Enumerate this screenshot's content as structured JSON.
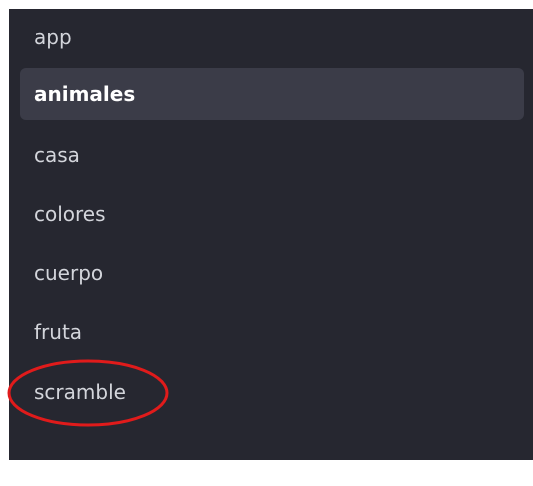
{
  "sidebar": {
    "items": [
      {
        "label": "app",
        "active": false
      },
      {
        "label": "animales",
        "active": true
      },
      {
        "label": "casa",
        "active": false
      },
      {
        "label": "colores",
        "active": false
      },
      {
        "label": "cuerpo",
        "active": false
      },
      {
        "label": "fruta",
        "active": false
      },
      {
        "label": "scramble",
        "active": false
      }
    ]
  },
  "annotation": {
    "target": "scramble",
    "color": "#e01b1b"
  },
  "colors": {
    "panel_background": "#262730",
    "active_background": "#3b3c48",
    "text": "#d3d5db",
    "active_text": "#ffffff"
  }
}
